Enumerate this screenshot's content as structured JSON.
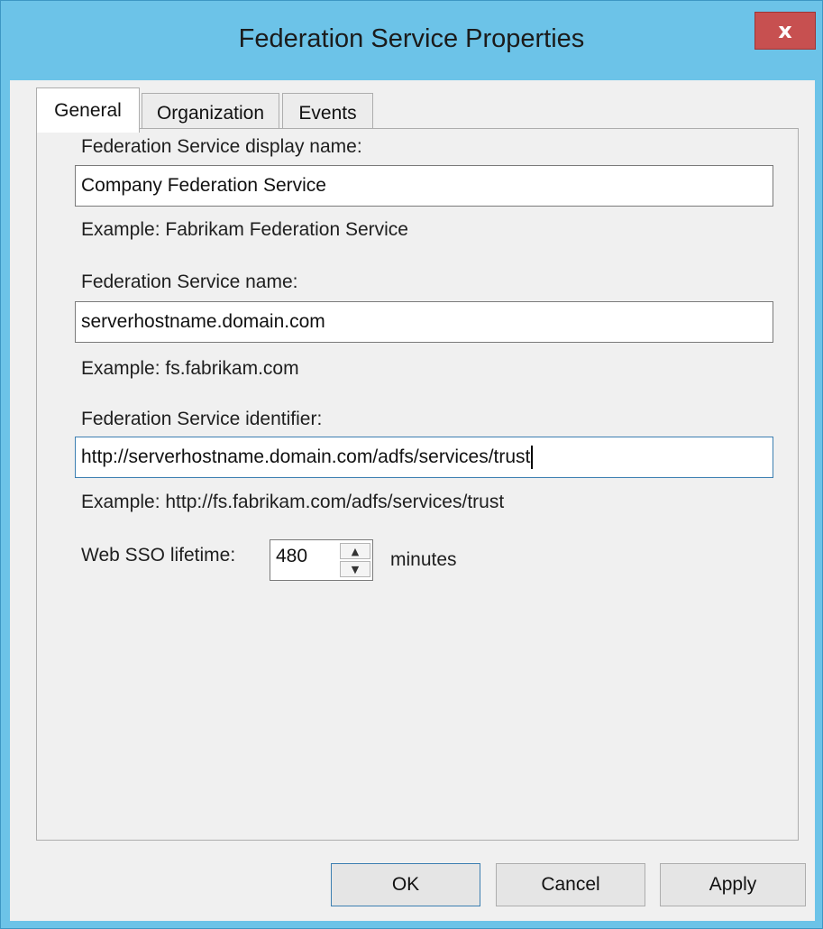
{
  "window": {
    "title": "Federation Service Properties",
    "close_glyph": "x"
  },
  "tabs": [
    {
      "label": "General",
      "active": true
    },
    {
      "label": "Organization",
      "active": false
    },
    {
      "label": "Events",
      "active": false
    }
  ],
  "general": {
    "display_name_label": "Federation Service display name:",
    "display_name_value": "Company Federation Service",
    "display_name_example": "Example: Fabrikam Federation Service",
    "service_name_label": "Federation Service name:",
    "service_name_value": "serverhostname.domain.com",
    "service_name_example": "Example: fs.fabrikam.com",
    "identifier_label": "Federation Service identifier:",
    "identifier_value": "http://serverhostname.domain.com/adfs/services/trust",
    "identifier_example": "Example: http://fs.fabrikam.com/adfs/services/trust",
    "sso_label": "Web SSO lifetime:",
    "sso_value": "480",
    "sso_unit": "minutes",
    "spin_up_glyph": "▲",
    "spin_down_glyph": "▼"
  },
  "buttons": {
    "ok": "OK",
    "cancel": "Cancel",
    "apply": "Apply"
  },
  "colors": {
    "title_bar": "#6cc3e8",
    "close_button": "#c75050",
    "dialog_background": "#f0f0f0",
    "focus_border": "#3c7fb1"
  },
  "icons": {
    "close": "close-icon",
    "spin_up": "chevron-up-icon",
    "spin_down": "chevron-down-icon"
  }
}
